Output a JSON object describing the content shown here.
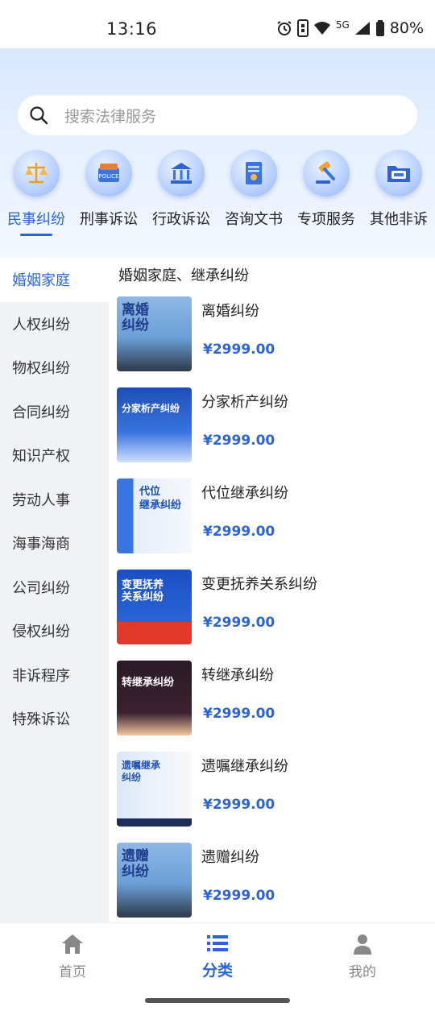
{
  "status_bar": {
    "time": "13:16",
    "network": "5G",
    "battery": "80%"
  },
  "search": {
    "placeholder": "搜索法律服务"
  },
  "categories": [
    {
      "label": "民事纠纷",
      "icon": "scales-icon"
    },
    {
      "label": "刑事诉讼",
      "icon": "police-icon"
    },
    {
      "label": "行政诉讼",
      "icon": "government-building-icon"
    },
    {
      "label": "咨询文书",
      "icon": "document-icon"
    },
    {
      "label": "专项服务",
      "icon": "gavel-icon"
    },
    {
      "label": "其他非诉",
      "icon": "folder-icon"
    }
  ],
  "sidebar": {
    "items": [
      "婚姻家庭",
      "人权纠纷",
      "物权纠纷",
      "合同纠纷",
      "知识产权",
      "劳动人事",
      "海事海商",
      "公司纠纷",
      "侵权纠纷",
      "非诉程序",
      "特殊诉讼"
    ]
  },
  "content": {
    "section_title": "婚姻家庭、继承纠纷",
    "products": [
      {
        "name": "离婚纠纷",
        "price": "¥2999.00",
        "thumb_text": "离婚\n纠纷",
        "thumb_color": "#6a9fd6"
      },
      {
        "name": "分家析产纠纷",
        "price": "¥2999.00",
        "thumb_text": "分家析产纠纷",
        "thumb_color": "#2d5fbf"
      },
      {
        "name": "代位继承纠纷",
        "price": "¥2999.00",
        "thumb_text": "代位\n继承纠纷",
        "thumb_color": "#dbe8f8"
      },
      {
        "name": "变更抚养关系纠纷",
        "price": "¥2999.00",
        "thumb_text": "变更抚养\n关系纠纷",
        "thumb_color": "#1b4fc4"
      },
      {
        "name": "转继承纠纷",
        "price": "¥2999.00",
        "thumb_text": "转继承纠纷",
        "thumb_color": "#2a1a26"
      },
      {
        "name": "遗嘱继承纠纷",
        "price": "¥2999.00",
        "thumb_text": "遗嘱继承\n纠纷",
        "thumb_color": "#e8f0fb"
      },
      {
        "name": "遗赠纠纷",
        "price": "¥2999.00",
        "thumb_text": "遗赠\n纠纷",
        "thumb_color": "#6a9fd6"
      }
    ]
  },
  "tabbar": {
    "items": [
      {
        "label": "首页",
        "icon": "home-icon"
      },
      {
        "label": "分类",
        "icon": "list-icon"
      },
      {
        "label": "我的",
        "icon": "user-icon"
      }
    ]
  },
  "colors": {
    "accent": "#2a64d6"
  }
}
